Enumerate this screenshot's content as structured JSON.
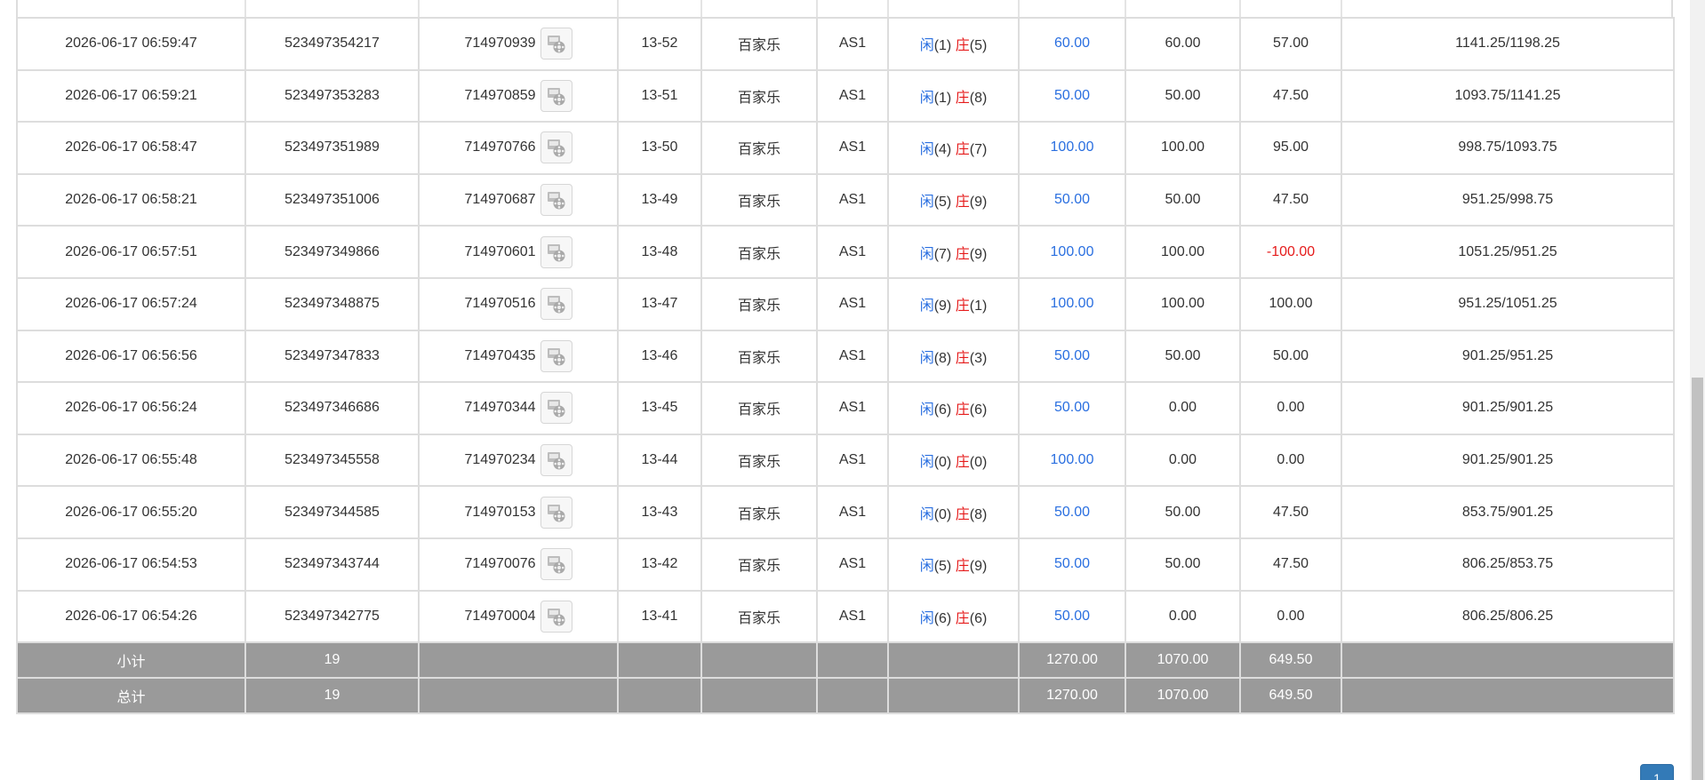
{
  "banker_char": "庄",
  "player_char": "闲",
  "colors": {
    "player": "#2a6fe0",
    "banker": "#e51c1c",
    "bet": "#2a6fe0",
    "summary_bg": "#9a9a9a",
    "pager": "#337ab7"
  },
  "icons": {
    "replay": "video-replay-icon"
  },
  "rows": [
    {
      "time": "2026-06-17 06:59:47",
      "order": "523497354217",
      "game": "714970939",
      "round": "13-52",
      "type": "百家乐",
      "table": "AS1",
      "player_pts": "(1)",
      "banker_pts": "(5)",
      "bet": "60.00",
      "valid": "60.00",
      "win": "57.00",
      "balance": "1141.25/1198.25"
    },
    {
      "time": "2026-06-17 06:59:21",
      "order": "523497353283",
      "game": "714970859",
      "round": "13-51",
      "type": "百家乐",
      "table": "AS1",
      "player_pts": "(1)",
      "banker_pts": "(8)",
      "bet": "50.00",
      "valid": "50.00",
      "win": "47.50",
      "balance": "1093.75/1141.25"
    },
    {
      "time": "2026-06-17 06:58:47",
      "order": "523497351989",
      "game": "714970766",
      "round": "13-50",
      "type": "百家乐",
      "table": "AS1",
      "player_pts": "(4)",
      "banker_pts": "(7)",
      "bet": "100.00",
      "valid": "100.00",
      "win": "95.00",
      "balance": "998.75/1093.75"
    },
    {
      "time": "2026-06-17 06:58:21",
      "order": "523497351006",
      "game": "714970687",
      "round": "13-49",
      "type": "百家乐",
      "table": "AS1",
      "player_pts": "(5)",
      "banker_pts": "(9)",
      "bet": "50.00",
      "valid": "50.00",
      "win": "47.50",
      "balance": "951.25/998.75"
    },
    {
      "time": "2026-06-17 06:57:51",
      "order": "523497349866",
      "game": "714970601",
      "round": "13-48",
      "type": "百家乐",
      "table": "AS1",
      "player_pts": "(7)",
      "banker_pts": "(9)",
      "bet": "100.00",
      "valid": "100.00",
      "win": "-100.00",
      "balance": "1051.25/951.25"
    },
    {
      "time": "2026-06-17 06:57:24",
      "order": "523497348875",
      "game": "714970516",
      "round": "13-47",
      "type": "百家乐",
      "table": "AS1",
      "player_pts": "(9)",
      "banker_pts": "(1)",
      "bet": "100.00",
      "valid": "100.00",
      "win": "100.00",
      "balance": "951.25/1051.25"
    },
    {
      "time": "2026-06-17 06:56:56",
      "order": "523497347833",
      "game": "714970435",
      "round": "13-46",
      "type": "百家乐",
      "table": "AS1",
      "player_pts": "(8)",
      "banker_pts": "(3)",
      "bet": "50.00",
      "valid": "50.00",
      "win": "50.00",
      "balance": "901.25/951.25"
    },
    {
      "time": "2026-06-17 06:56:24",
      "order": "523497346686",
      "game": "714970344",
      "round": "13-45",
      "type": "百家乐",
      "table": "AS1",
      "player_pts": "(6)",
      "banker_pts": "(6)",
      "bet": "50.00",
      "valid": "0.00",
      "win": "0.00",
      "balance": "901.25/901.25"
    },
    {
      "time": "2026-06-17 06:55:48",
      "order": "523497345558",
      "game": "714970234",
      "round": "13-44",
      "type": "百家乐",
      "table": "AS1",
      "player_pts": "(0)",
      "banker_pts": "(0)",
      "bet": "100.00",
      "valid": "0.00",
      "win": "0.00",
      "balance": "901.25/901.25"
    },
    {
      "time": "2026-06-17 06:55:20",
      "order": "523497344585",
      "game": "714970153",
      "round": "13-43",
      "type": "百家乐",
      "table": "AS1",
      "player_pts": "(0)",
      "banker_pts": "(8)",
      "bet": "50.00",
      "valid": "50.00",
      "win": "47.50",
      "balance": "853.75/901.25"
    },
    {
      "time": "2026-06-17 06:54:53",
      "order": "523497343744",
      "game": "714970076",
      "round": "13-42",
      "type": "百家乐",
      "table": "AS1",
      "player_pts": "(5)",
      "banker_pts": "(9)",
      "bet": "50.00",
      "valid": "50.00",
      "win": "47.50",
      "balance": "806.25/853.75"
    },
    {
      "time": "2026-06-17 06:54:26",
      "order": "523497342775",
      "game": "714970004",
      "round": "13-41",
      "type": "百家乐",
      "table": "AS1",
      "player_pts": "(6)",
      "banker_pts": "(6)",
      "bet": "50.00",
      "valid": "0.00",
      "win": "0.00",
      "balance": "806.25/806.25"
    }
  ],
  "summary": [
    {
      "label": "小计",
      "count": "19",
      "bet": "1270.00",
      "valid": "1070.00",
      "win": "649.50"
    },
    {
      "label": "总计",
      "count": "19",
      "bet": "1270.00",
      "valid": "1070.00",
      "win": "649.50"
    }
  ],
  "pagination": {
    "current_page": "1"
  }
}
